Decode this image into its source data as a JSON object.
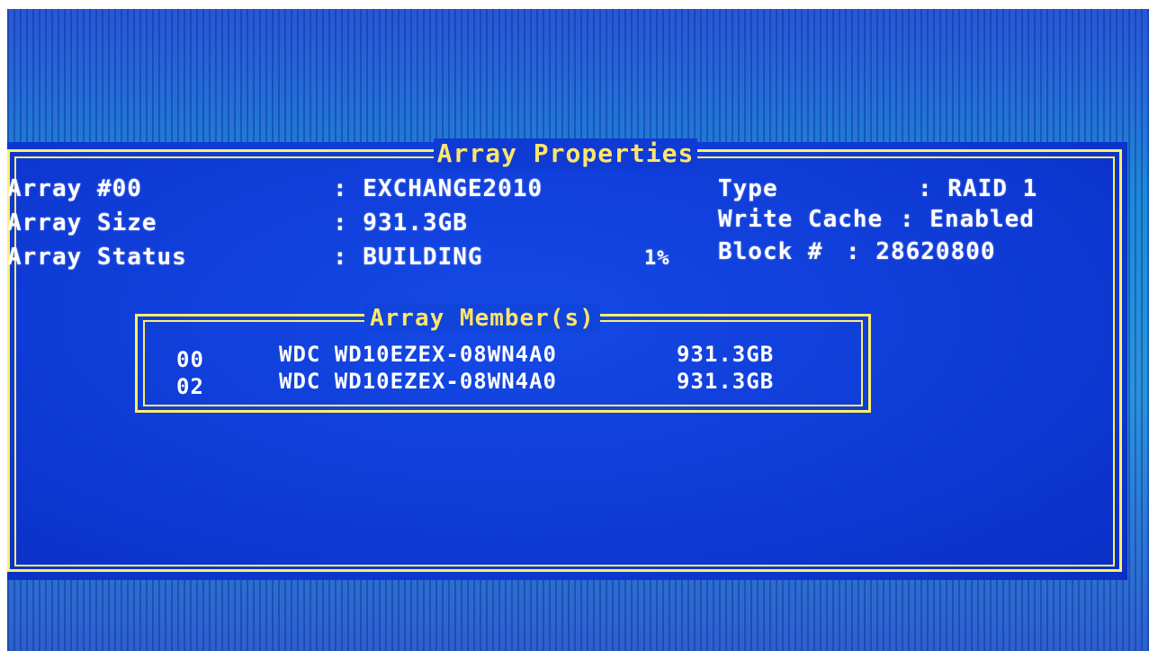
{
  "dialog": {
    "title": "Array Properties"
  },
  "properties": {
    "array_number_label": "Array #00",
    "array_name": ": EXCHANGE2010",
    "array_size_label": "Array Size",
    "array_size_value": ": 931.3GB",
    "array_status_label": "Array Status",
    "array_status_value": ": BUILDING",
    "build_progress": "1%",
    "type_label": "Type",
    "type_value": ": RAID 1",
    "write_cache_label": "Write Cache",
    "write_cache_value": ": Enabled",
    "block_label": "Block #",
    "block_value": ": 28620800"
  },
  "members": {
    "title": "Array Member(s)",
    "rows": [
      {
        "id": "00",
        "model": "WDC WD10EZEX-08WN4A0",
        "size": "931.3GB"
      },
      {
        "id": "02",
        "model": "WDC WD10EZEX-08WN4A0",
        "size": "931.3GB"
      }
    ]
  },
  "colors": {
    "background": "#1a86d4",
    "dialog": "#0f3bd6",
    "border": "#ffef6a",
    "title_text": "#ffe56a",
    "text": "#ffffff"
  }
}
